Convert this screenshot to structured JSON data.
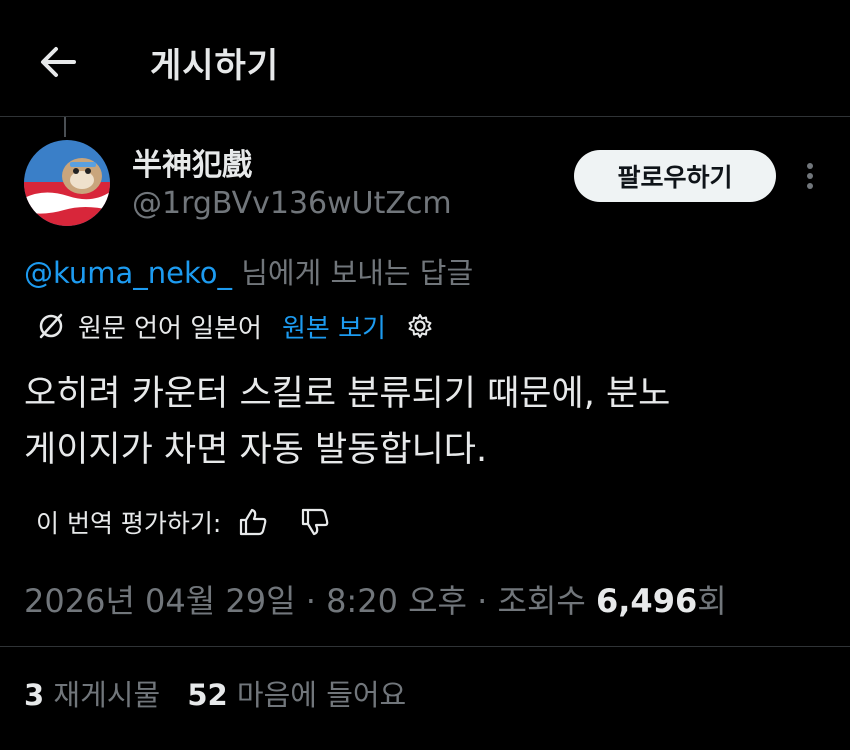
{
  "header": {
    "title": "게시하기",
    "back_icon": "arrow-left-icon"
  },
  "author": {
    "display_name": "半神犯戲",
    "handle": "@1rgBVv136wUtZcm",
    "avatar_icon": "avatar-image",
    "follow_label": "팔로우하기",
    "more_icon": "more-vertical-icon"
  },
  "reply_to": {
    "mention": "@kuma_neko_",
    "suffix": " 님에게 보내는 답글"
  },
  "translation": {
    "icon": "translate-icon",
    "source_text": "원문 언어 일본어",
    "view_original": "원본 보기",
    "settings_icon": "settings-icon"
  },
  "post": {
    "lines": [
      "오히려 카운터 스킬로 분류되기 때문에, 분노",
      "게이지가 차면 자동 발동합니다."
    ]
  },
  "rating": {
    "label": "이 번역 평가하기:",
    "like_icon": "thumbs-up-icon",
    "dislike_icon": "thumbs-down-icon"
  },
  "meta": {
    "date": "2026년 04월 29일",
    "separator": " · ",
    "time": "8:20 오후",
    "views_label": "조회수 ",
    "views_count": "6,496",
    "views_suffix": "회"
  },
  "stats": {
    "reposts_count": "3",
    "reposts_label": " 재게시물",
    "likes_count": "52",
    "likes_label": " 마음에 들어요"
  },
  "colors": {
    "accent": "#1d9bf0",
    "muted": "#71767b",
    "text": "#e7e9ea",
    "background": "#000000"
  }
}
